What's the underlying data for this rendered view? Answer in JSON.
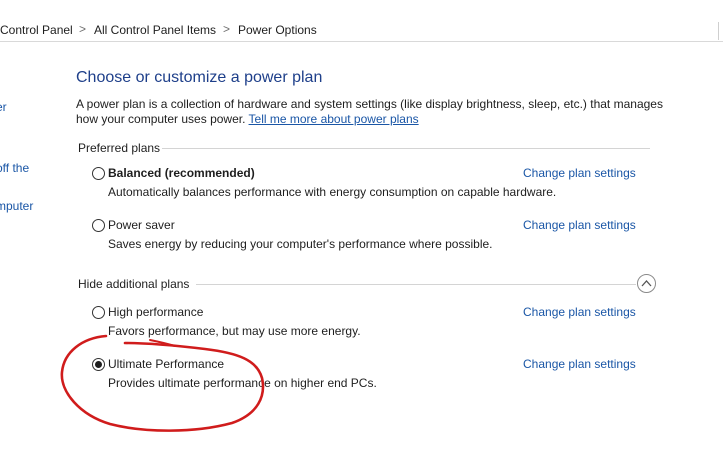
{
  "breadcrumb": {
    "items": [
      "Control Panel",
      "All Control Panel Items",
      "Power Options"
    ],
    "separator": ">"
  },
  "left_nav": {
    "fragments": [
      "er",
      "off the",
      "mputer"
    ]
  },
  "main": {
    "title": "Choose or customize a power plan",
    "description": "A power plan is a collection of hardware and system settings (like display brightness, sleep, etc.) that manages how your computer uses power.",
    "learn_more_link": "Tell me more about power plans",
    "preferred_header": "Preferred plans",
    "additional_header": "Hide additional plans",
    "change_label": "Change plan settings",
    "plans": [
      {
        "name": "Balanced (recommended)",
        "description": "Automatically balances performance with energy consumption on capable hardware.",
        "selected": false
      },
      {
        "name": "Power saver",
        "description": "Saves energy by reducing your computer's performance where possible.",
        "selected": false
      },
      {
        "name": "High performance",
        "description": "Favors performance, but may use more energy.",
        "selected": false
      },
      {
        "name": "Ultimate Performance",
        "description": "Provides ultimate performance on higher end PCs.",
        "selected": true
      }
    ]
  },
  "colors": {
    "link": "#1a56a6",
    "title": "#1e3f8a",
    "annotation": "#d01c1c"
  },
  "icons": {
    "collapse": "chevron-up-icon",
    "selected_radio": "radio-selected-icon"
  }
}
